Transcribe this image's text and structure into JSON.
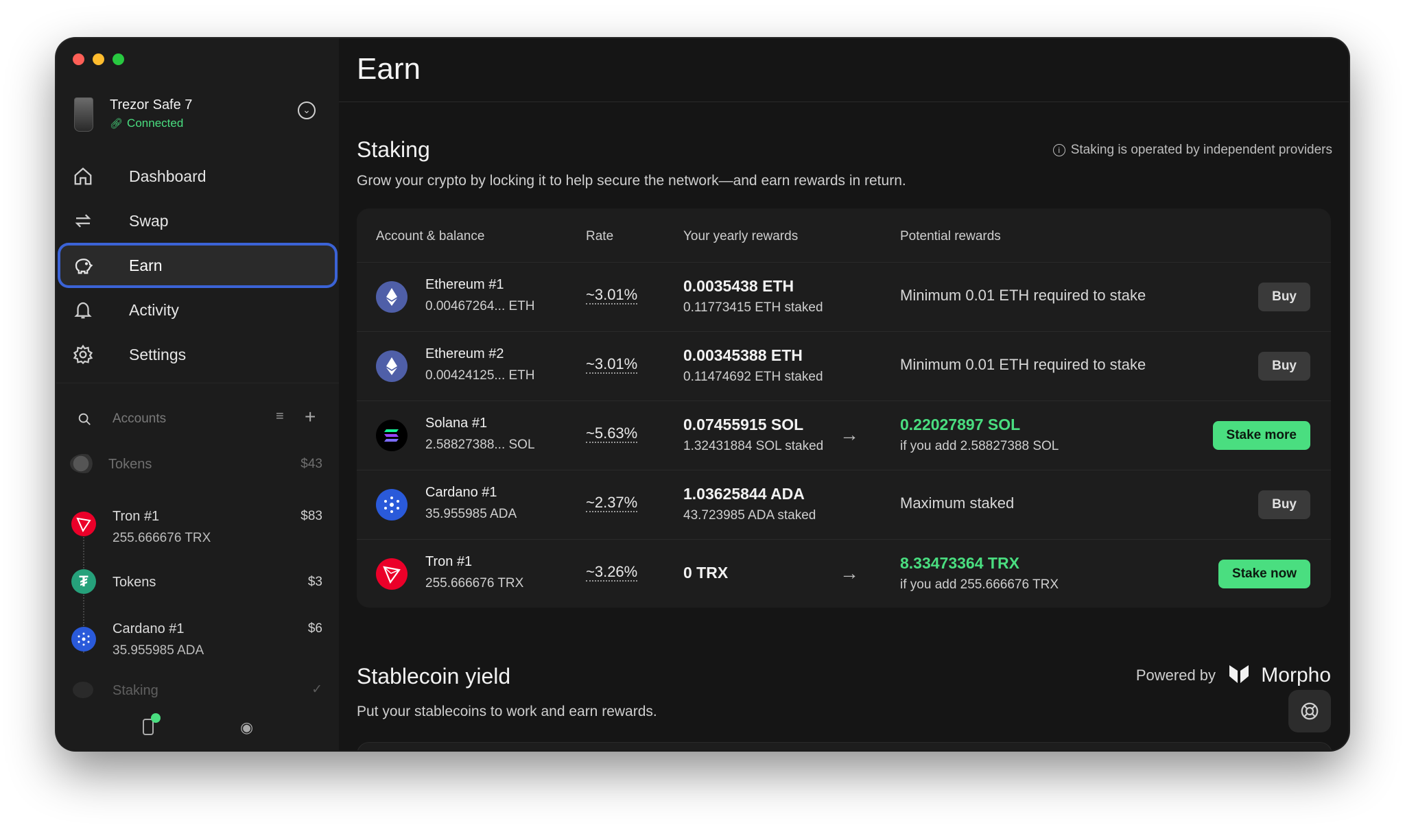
{
  "sidebar": {
    "device": {
      "name": "Trezor Safe 7",
      "status": "Connected"
    },
    "nav": [
      {
        "label": "Dashboard",
        "icon": "home-icon"
      },
      {
        "label": "Swap",
        "icon": "swap-icon"
      },
      {
        "label": "Earn",
        "icon": "piggy-bank-icon",
        "active": true
      },
      {
        "label": "Activity",
        "icon": "bell-icon"
      },
      {
        "label": "Settings",
        "icon": "gear-icon"
      }
    ],
    "accounts_label": "Accounts",
    "accounts": {
      "tokens_top": {
        "name": "Tokens",
        "value": "$43"
      },
      "tron": {
        "name": "Tron #1",
        "balance": "255.666676 TRX",
        "value": "$83"
      },
      "tron_tokens": {
        "name": "Tokens",
        "value": "$3"
      },
      "cardano": {
        "name": "Cardano #1",
        "balance": "35.955985 ADA",
        "value": "$6"
      },
      "staking": {
        "name": "Staking"
      }
    }
  },
  "main": {
    "title": "Earn",
    "staking": {
      "title": "Staking",
      "description": "Grow your crypto by locking it to help secure the network—and earn rewards in return.",
      "note": "Staking is operated by independent providers",
      "columns": [
        "Account & balance",
        "Rate",
        "Your yearly rewards",
        "Potential rewards"
      ],
      "rows": [
        {
          "name": "Ethereum #1",
          "balance": "0.00467264... ETH",
          "rate": "~3.01%",
          "yearly": "0.0035438 ETH",
          "staked": "0.11773415 ETH staked",
          "potential": "Minimum 0.01 ETH required to stake",
          "button": "Buy"
        },
        {
          "name": "Ethereum #2",
          "balance": "0.00424125... ETH",
          "rate": "~3.01%",
          "yearly": "0.00345388 ETH",
          "staked": "0.11474692 ETH staked",
          "potential": "Minimum 0.01 ETH required to stake",
          "button": "Buy"
        },
        {
          "name": "Solana #1",
          "balance": "2.58827388... SOL",
          "rate": "~5.63%",
          "yearly": "0.07455915 SOL",
          "staked": "1.32431884 SOL staked",
          "potential": "0.22027897 SOL",
          "potential_sub": "if you add 2.58827388 SOL",
          "button": "Stake more"
        },
        {
          "name": "Cardano #1",
          "balance": "35.955985 ADA",
          "rate": "~2.37%",
          "yearly": "1.03625844 ADA",
          "staked": "43.723985 ADA staked",
          "potential": "Maximum staked",
          "button": "Buy"
        },
        {
          "name": "Tron #1",
          "balance": "255.666676 TRX",
          "rate": "~3.26%",
          "yearly": "0 TRX",
          "potential": "8.33473364 TRX",
          "potential_sub": "if you add 255.666676 TRX",
          "button": "Stake now"
        }
      ]
    },
    "stablecoin": {
      "title": "Stablecoin yield",
      "description": "Put your stablecoins to work and earn rewards.",
      "powered_by": "Powered by",
      "brand": "Morpho"
    }
  },
  "colors": {
    "accent_green": "#4ade80",
    "active_outline": "#3b63d6",
    "background": "#151515"
  }
}
